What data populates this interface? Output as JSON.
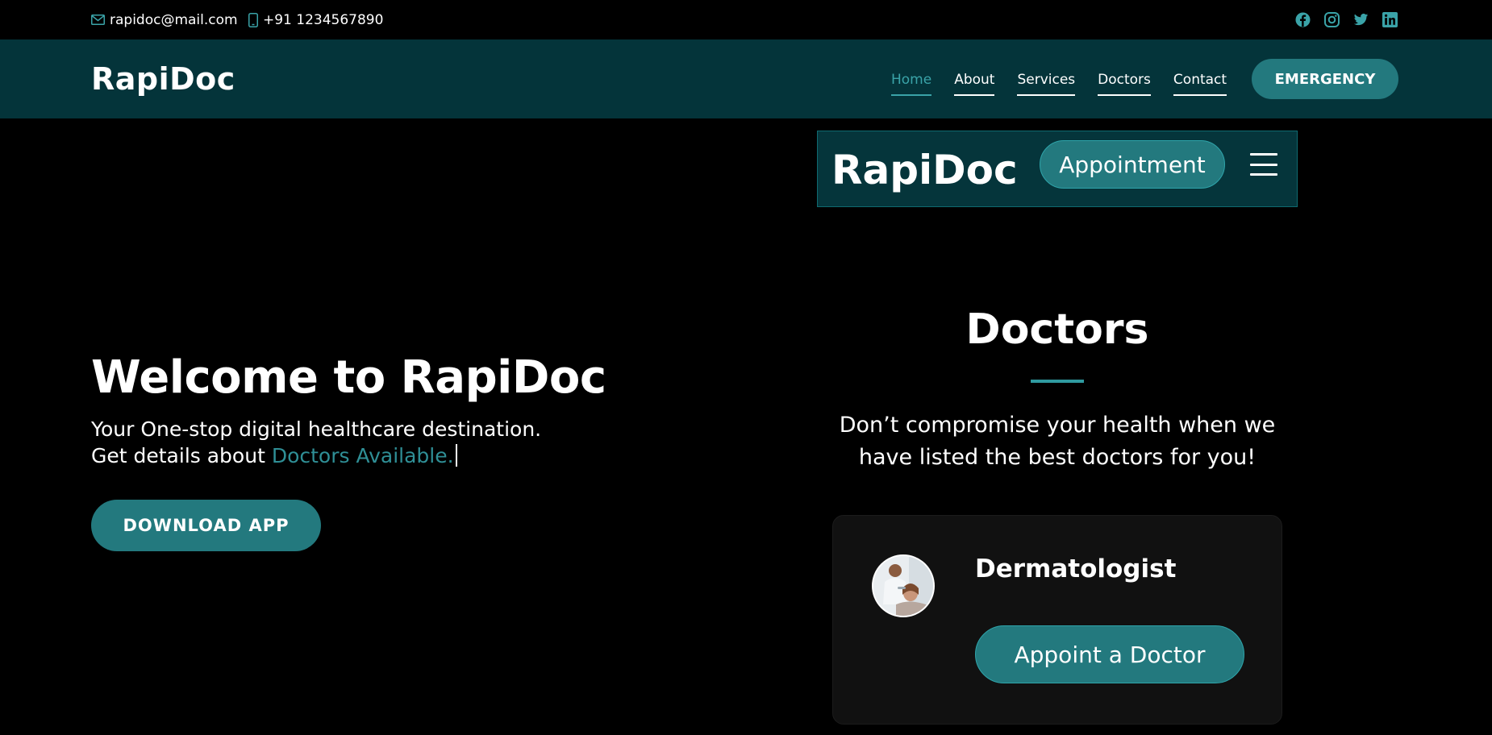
{
  "topbar": {
    "email": "rapidoc@mail.com",
    "phone": "+91 1234567890",
    "icons": [
      "mail-icon",
      "phone-icon",
      "facebook-icon",
      "instagram-icon",
      "twitter-icon",
      "linkedin-icon"
    ]
  },
  "header": {
    "brand": "RapiDoc",
    "nav": [
      {
        "label": "Home",
        "active": true
      },
      {
        "label": "About",
        "active": false
      },
      {
        "label": "Services",
        "active": false
      },
      {
        "label": "Doctors",
        "active": false
      },
      {
        "label": "Contact",
        "active": false
      }
    ],
    "emergency_label": "EMERGENCY"
  },
  "hero": {
    "title": "Welcome to RapiDoc",
    "subtitle_line1": "Your One-stop digital healthcare destination.",
    "subtitle_line2_prefix": "Get details about",
    "subtitle_line2_accent": "Doctors Available.",
    "download_label": "DOWNLOAD APP"
  },
  "mobile_nav": {
    "brand": "RapiDoc",
    "appointment_label": "Appointment"
  },
  "doctors": {
    "title": "Doctors",
    "description": "Don’t compromise your health when we have listed the best doctors for you!",
    "card": {
      "specialty": "Dermatologist",
      "button_label": "Appoint a Doctor"
    }
  },
  "colors": {
    "background": "#000000",
    "header": "#04343a",
    "accent": "#23797e",
    "accent_text": "#2f8f96",
    "card": "#111111"
  }
}
